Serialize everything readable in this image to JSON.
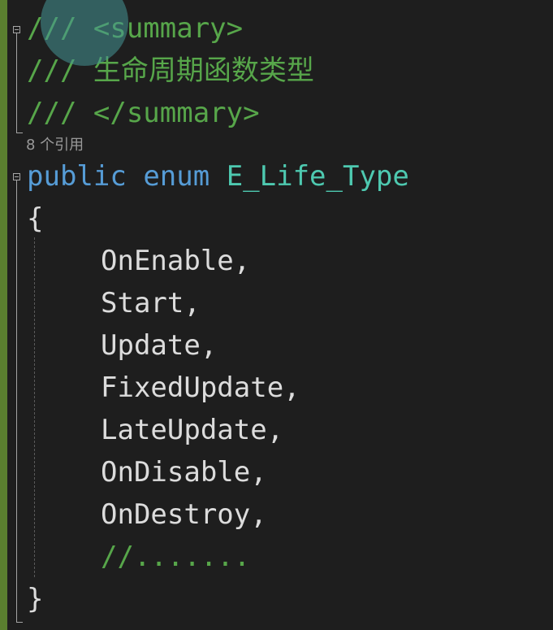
{
  "code": {
    "summary_open": "/// <summary>",
    "summary_text": "/// 生命周期函数类型",
    "summary_close": "/// </summary>",
    "codelens": "8 个引用",
    "decl_public": "public",
    "decl_enum": "enum",
    "decl_type": "E_Life_Type",
    "brace_open": "{",
    "members": [
      "OnEnable,",
      "Start,",
      "Update,",
      "FixedUpdate,",
      "LateUpdate,",
      "OnDisable,",
      "OnDestroy,"
    ],
    "trailing_comment": "//.......",
    "brace_close": "}"
  },
  "colors": {
    "comment": "#57a64a",
    "keyword": "#569cd6",
    "type": "#4ec9b0",
    "plain": "#dcdcdc",
    "change_bar": "#5a7f2f",
    "background": "#1e1e1e"
  }
}
